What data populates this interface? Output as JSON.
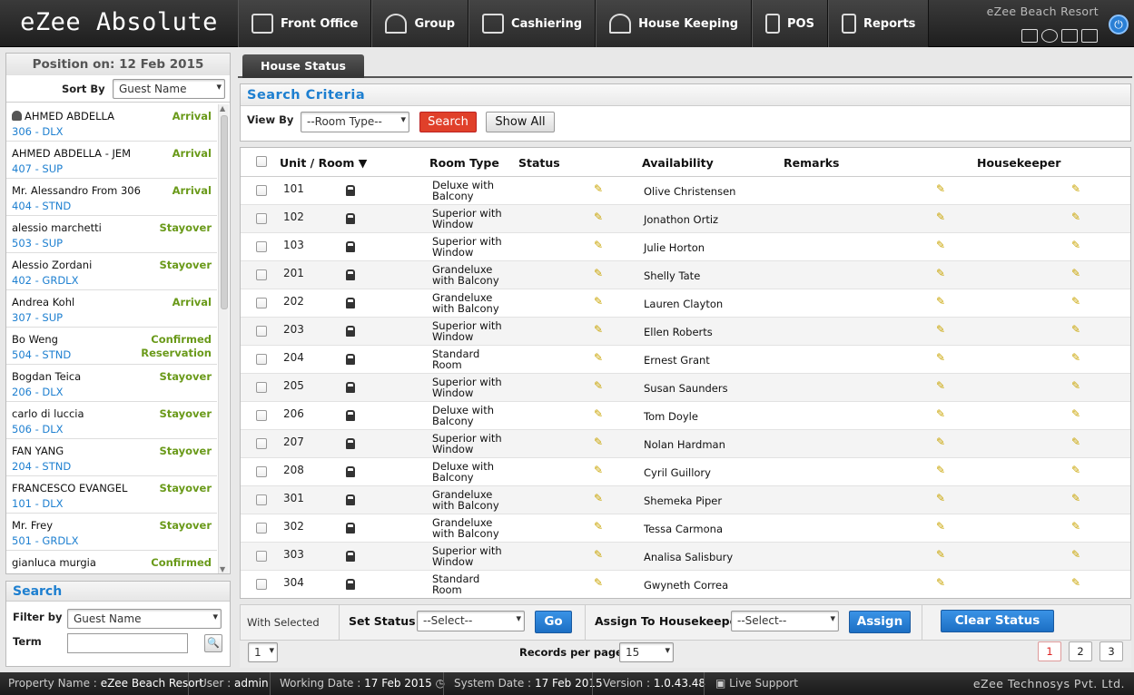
{
  "app": {
    "title": "eZee Absolute",
    "resort": "eZee Beach Resort"
  },
  "nav": [
    {
      "label": "Front Office",
      "icon": "front-office-icon"
    },
    {
      "label": "Group",
      "icon": "group-icon"
    },
    {
      "label": "Cashiering",
      "icon": "cashiering-icon"
    },
    {
      "label": "House Keeping",
      "icon": "housekeeping-icon"
    },
    {
      "label": "POS",
      "icon": "pos-icon"
    },
    {
      "label": "Reports",
      "icon": "reports-icon"
    }
  ],
  "left": {
    "position_title": "Position on: 12 Feb 2015",
    "sort_label": "Sort By",
    "sort_value": "Guest Name",
    "guests": [
      {
        "name": "AHMED ABDELLA",
        "room": "306 - DLX",
        "status": "Arrival",
        "icon": "user-icon"
      },
      {
        "name": "AHMED ABDELLA - JEM",
        "room": "407 - SUP",
        "status": "Arrival"
      },
      {
        "name": "Mr. Alessandro From 306",
        "room": "404 - STND",
        "status": "Arrival"
      },
      {
        "name": "alessio marchetti",
        "room": "503 - SUP",
        "status": "Stayover"
      },
      {
        "name": "Alessio Zordani",
        "room": "402 - GRDLX",
        "status": "Stayover"
      },
      {
        "name": "Andrea Kohl",
        "room": "307 - SUP",
        "status": "Arrival"
      },
      {
        "name": "Bo Weng",
        "room": "504 - STND",
        "status": "Confirmed Reservation"
      },
      {
        "name": "Bogdan Teica",
        "room": "206 - DLX",
        "status": "Stayover"
      },
      {
        "name": "carlo di luccia",
        "room": "506 - DLX",
        "status": "Stayover"
      },
      {
        "name": "FAN YANG",
        "room": "204 - STND",
        "status": "Stayover"
      },
      {
        "name": "FRANCESCO EVANGEL",
        "room": "101 - DLX",
        "status": "Stayover"
      },
      {
        "name": "Mr. Frey",
        "room": "501 - GRDLX",
        "status": "Stayover"
      },
      {
        "name": "gianluca murgia",
        "room": "",
        "status": "Confirmed"
      }
    ],
    "search_title": "Search",
    "filter_label": "Filter by",
    "filter_value": "Guest Name",
    "term_label": "Term",
    "term_value": ""
  },
  "main": {
    "tab": "House Status",
    "criteria_title": "Search Criteria",
    "view_by_label": "View By",
    "room_type_value": "--Room Type--",
    "search_btn": "Search",
    "showall_btn": "Show All",
    "headers": {
      "unit": "Unit / Room",
      "room_type": "Room Type",
      "status": "Status",
      "availability": "Availability",
      "remarks": "Remarks",
      "housekeeper": "Housekeeper"
    },
    "rows": [
      {
        "room": "101",
        "type": "Deluxe with Balcony",
        "hk": "Olive Christensen"
      },
      {
        "room": "102",
        "type": "Superior with Window",
        "hk": "Jonathon Ortiz"
      },
      {
        "room": "103",
        "type": "Superior with Window",
        "hk": "Julie Horton"
      },
      {
        "room": "201",
        "type": "Grandeluxe with Balcony",
        "hk": "Shelly Tate"
      },
      {
        "room": "202",
        "type": "Grandeluxe with Balcony",
        "hk": "Lauren Clayton"
      },
      {
        "room": "203",
        "type": "Superior with Window",
        "hk": "Ellen Roberts"
      },
      {
        "room": "204",
        "type": "Standard Room",
        "hk": "Ernest Grant"
      },
      {
        "room": "205",
        "type": "Superior with Window",
        "hk": "Susan Saunders"
      },
      {
        "room": "206",
        "type": "Deluxe with Balcony",
        "hk": "Tom Doyle"
      },
      {
        "room": "207",
        "type": "Superior with Window",
        "hk": "Nolan Hardman"
      },
      {
        "room": "208",
        "type": "Deluxe with Balcony",
        "hk": "Cyril Guillory"
      },
      {
        "room": "301",
        "type": "Grandeluxe with Balcony",
        "hk": "Shemeka Piper"
      },
      {
        "room": "302",
        "type": "Grandeluxe with Balcony",
        "hk": "Tessa Carmona"
      },
      {
        "room": "303",
        "type": "Superior with Window",
        "hk": "Analisa Salisbury"
      },
      {
        "room": "304",
        "type": "Standard Room",
        "hk": "Gwyneth Correa"
      }
    ],
    "with_selected": "With Selected",
    "set_status": "Set Status",
    "status_select": "--Select--",
    "go_btn": "Go",
    "assign_label": "Assign To Housekeeper",
    "assign_select": "--Select--",
    "assign_btn": "Assign",
    "clear_btn": "Clear Status",
    "page_select": "1",
    "records_label": "Records per page",
    "records_value": "15",
    "pages": [
      "1",
      "2",
      "3"
    ]
  },
  "status": {
    "property_label": "Property Name :",
    "property": "eZee Beach Resort",
    "user_label": "User :",
    "user": "admin",
    "working_label": "Working Date :",
    "working": "17 Feb 2015",
    "system_label": "System Date :",
    "system": "17 Feb 2015",
    "version_label": "Version :",
    "version": "1.0.43.48",
    "support": "Live Support",
    "company": "eZee Technosys Pvt. Ltd."
  }
}
